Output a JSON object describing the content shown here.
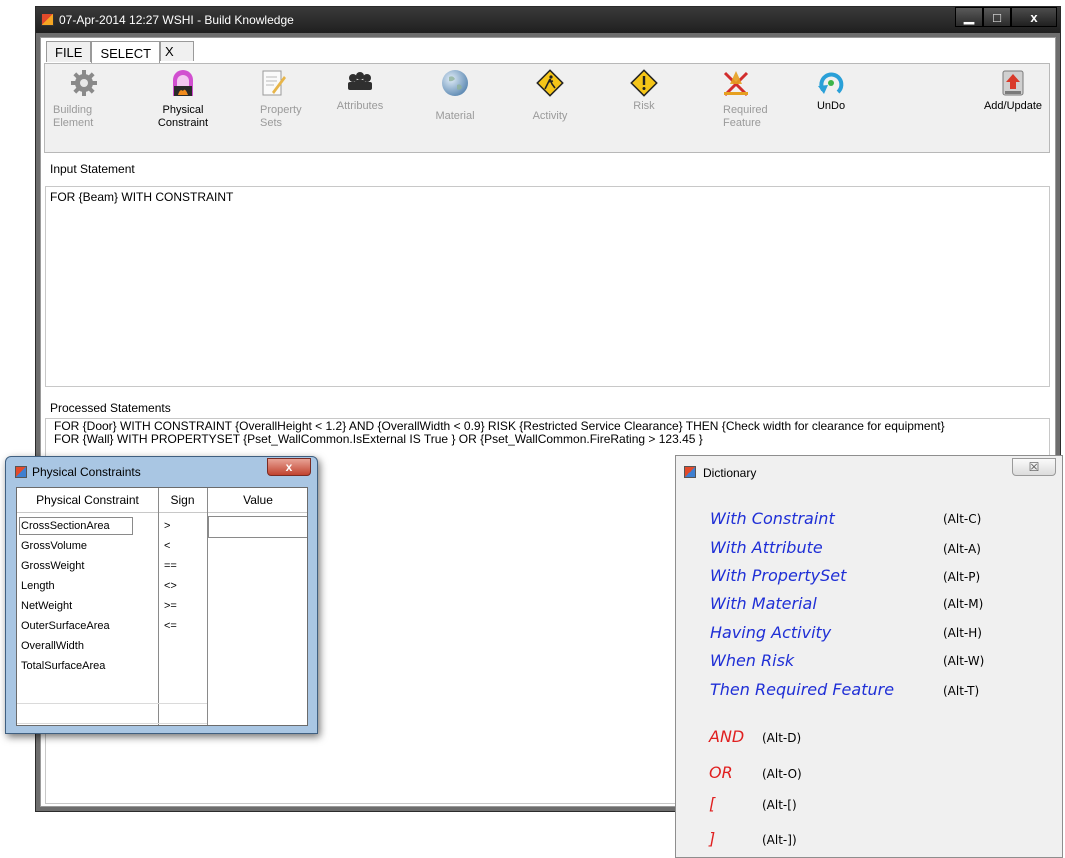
{
  "window": {
    "title": "07-Apr-2014 12:27    WSHI - Build Knowledge",
    "min_glyph": "▁",
    "max_glyph": "□",
    "close_glyph": "x"
  },
  "tabs": [
    {
      "label": "FILE"
    },
    {
      "label": "SELECT"
    },
    {
      "label": "X"
    }
  ],
  "toolbar": [
    {
      "label": "Building\nElement",
      "icon": "gear-icon",
      "enabled": false
    },
    {
      "label": "Physical\nConstraint",
      "icon": "fireplace-icon",
      "enabled": true
    },
    {
      "label": "Property\nSets",
      "icon": "document-edit-icon",
      "enabled": false
    },
    {
      "label": "Attributes",
      "icon": "people-icon",
      "enabled": false
    },
    {
      "label": "Material",
      "icon": "globe-icon",
      "enabled": false
    },
    {
      "label": "Activity",
      "icon": "worker-sign-icon",
      "enabled": false
    },
    {
      "label": "Risk",
      "icon": "warning-icon",
      "enabled": false
    },
    {
      "label": "Required\nFeature",
      "icon": "tools-icon",
      "enabled": false
    },
    {
      "label": "UnDo",
      "icon": "undo-icon",
      "enabled": true
    },
    {
      "label": "Add/Update",
      "icon": "upload-icon",
      "enabled": true
    }
  ],
  "input": {
    "label": "Input Statement",
    "text": "FOR {Beam} WITH CONSTRAINT"
  },
  "processed": {
    "label": "Processed Statements",
    "lines": [
      "FOR {Door} WITH CONSTRAINT  {OverallHeight < 1.2} AND {OverallWidth < 0.9} RISK  {Restricted Service Clearance} THEN  {Check width for clearance for equipment}",
      "FOR {Wall} WITH PROPERTYSET  {Pset_WallCommon.IsExternal IS True }  OR {Pset_WallCommon.FireRating > 123.45 }"
    ]
  },
  "physical_constraints": {
    "title": "Physical Constraints",
    "close_glyph": "x",
    "columns": [
      "Physical Constraint",
      "Sign",
      "Value"
    ],
    "rows": [
      "CrossSectionArea",
      "GrossVolume",
      "GrossWeight",
      "Length",
      "NetWeight",
      "OuterSurfaceArea",
      "OverallWidth",
      "TotalSurfaceArea"
    ],
    "signs": [
      ">",
      "<",
      "==",
      "<>",
      ">=",
      "<="
    ]
  },
  "dictionary": {
    "title": "Dictionary",
    "close_glyph": "☒",
    "entries": [
      {
        "label": "With Constraint",
        "shortcut": "(Alt-C)"
      },
      {
        "label": "With Attribute",
        "shortcut": "(Alt-A)"
      },
      {
        "label": "With PropertySet",
        "shortcut": "(Alt-P)"
      },
      {
        "label": "With Material",
        "shortcut": "(Alt-M)"
      },
      {
        "label": "Having Activity",
        "shortcut": "(Alt-H)"
      },
      {
        "label": "When Risk",
        "shortcut": "(Alt-W)"
      },
      {
        "label": "Then Required Feature",
        "shortcut": "(Alt-T)"
      }
    ],
    "operators": [
      {
        "label": "AND",
        "shortcut": "(Alt-D)"
      },
      {
        "label": "OR",
        "shortcut": "(Alt-O)"
      },
      {
        "label": "[",
        "shortcut": "(Alt-[)"
      },
      {
        "label": "]",
        "shortcut": "(Alt-])"
      }
    ]
  },
  "colors": {
    "dictionary_keyword": "#1f2fd6",
    "dictionary_operator": "#e02020",
    "pc_frame": "#a9c6e3"
  }
}
